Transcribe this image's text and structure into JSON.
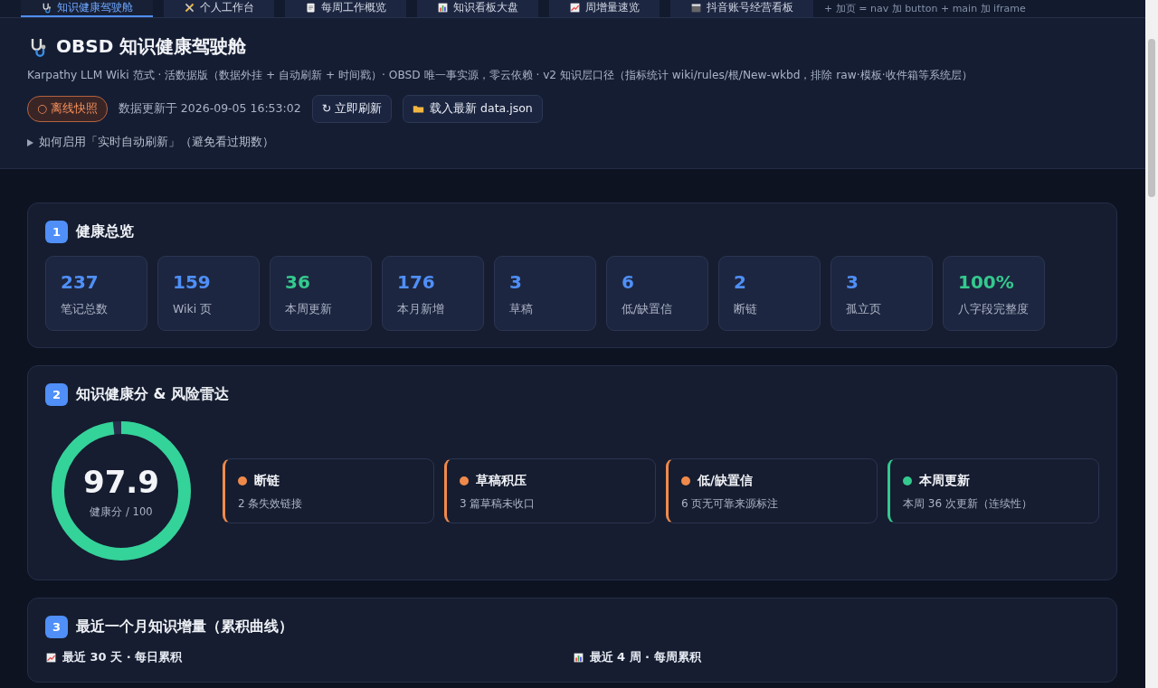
{
  "tabs": [
    {
      "label": "知识健康驾驶舱",
      "selected": true
    },
    {
      "label": "个人工作台",
      "selected": false
    },
    {
      "label": "每周工作概览",
      "selected": false
    },
    {
      "label": "知识看板大盘",
      "selected": false
    },
    {
      "label": "周增量速览",
      "selected": false
    },
    {
      "label": "抖音账号经营看板",
      "selected": false
    }
  ],
  "add_page_hint": "+ 加页 = nav 加 button + main 加 iframe",
  "header": {
    "title": "OBSD 知识健康驾驶舱",
    "subtitle": "Karpathy LLM Wiki 范式 · 活数据版（数据外挂 + 自动刷新 + 时间戳）· OBSD 唯一事实源，零云依赖 · v2 知识层口径（指标统计 wiki/rules/根/New-wkbd，排除 raw·模板·收件箱等系统层）",
    "status_badge": "○ 离线快照",
    "updated": "数据更新于 2026-09-05 16:53:02",
    "buttons": [
      "↻ 立即刷新",
      "载入最新 data.json"
    ],
    "disclosure": {
      "label": "如何启用「实时自动刷新」（避免看过期数）",
      "expanded": false
    }
  },
  "sections": [
    {
      "number": "1",
      "title": "健康总览",
      "kind": "stats",
      "stats": [
        {
          "value": "237",
          "label": "笔记总数",
          "color": "#4f8ff7"
        },
        {
          "value": "159",
          "label": "Wiki 页",
          "color": "#4f8ff7"
        },
        {
          "value": "36",
          "label": "本周更新",
          "color": "#34c98e"
        },
        {
          "value": "176",
          "label": "本月新增",
          "color": "#4f8ff7"
        },
        {
          "value": "3",
          "label": "草稿",
          "color": "#4f8ff7"
        },
        {
          "value": "6",
          "label": "低/缺置信",
          "color": "#4f8ff7"
        },
        {
          "value": "2",
          "label": "断链",
          "color": "#4f8ff7"
        },
        {
          "value": "3",
          "label": "孤立页",
          "color": "#4f8ff7"
        },
        {
          "value": "100%",
          "label": "八字段完整度",
          "color": "#34c98e"
        }
      ]
    },
    {
      "number": "2",
      "title": "知识健康分 & 风险雷达",
      "kind": "score",
      "score": {
        "value": "97.9",
        "caption": "健康分 / 100",
        "level": 0.979
      },
      "risks": [
        {
          "title": "断链",
          "detail": "2 条失效链接",
          "color": "#f08a4b"
        },
        {
          "title": "草稿积压",
          "detail": "3 篇草稿未收口",
          "color": "#f08a4b"
        },
        {
          "title": "低/缺置信",
          "detail": "6 页无可靠来源标注",
          "color": "#f08a4b"
        },
        {
          "title": "本周更新",
          "detail": "本周 36 次更新（连续性）",
          "color": "#34c98e"
        }
      ]
    },
    {
      "number": "3",
      "title": "最近一个月知识增量（累积曲线）",
      "kind": "charts",
      "subheads": [
        "最近 30 天 · 每日累积",
        "最近 4 周 · 每周累积"
      ]
    }
  ]
}
